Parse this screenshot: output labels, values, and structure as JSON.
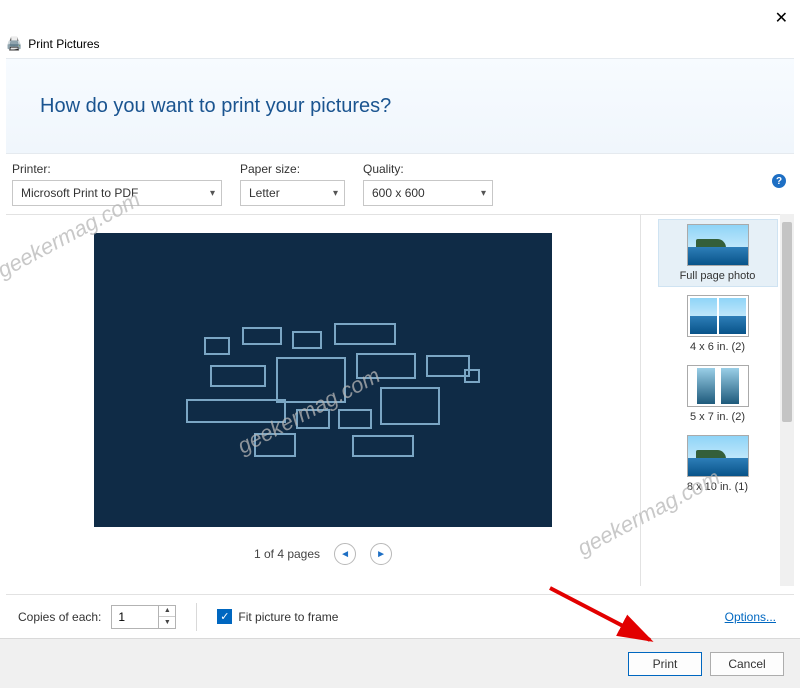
{
  "window": {
    "title": "Print Pictures",
    "heading": "How do you want to print your pictures?"
  },
  "fields": {
    "printer_label": "Printer:",
    "printer_value": "Microsoft Print to PDF",
    "paper_label": "Paper size:",
    "paper_value": "Letter",
    "quality_label": "Quality:",
    "quality_value": "600 x 600"
  },
  "pager": {
    "label": "1 of 4 pages"
  },
  "layouts": {
    "item0": "Full page photo",
    "item1": "4 x 6 in. (2)",
    "item2": "5 x 7 in. (2)",
    "item3": "8 x 10 in. (1)"
  },
  "bottom": {
    "copies_label": "Copies of each:",
    "copies_value": "1",
    "fit_label": "Fit picture to frame",
    "options_link": "Options..."
  },
  "actions": {
    "print": "Print",
    "cancel": "Cancel"
  },
  "watermark": "geekermag.com"
}
